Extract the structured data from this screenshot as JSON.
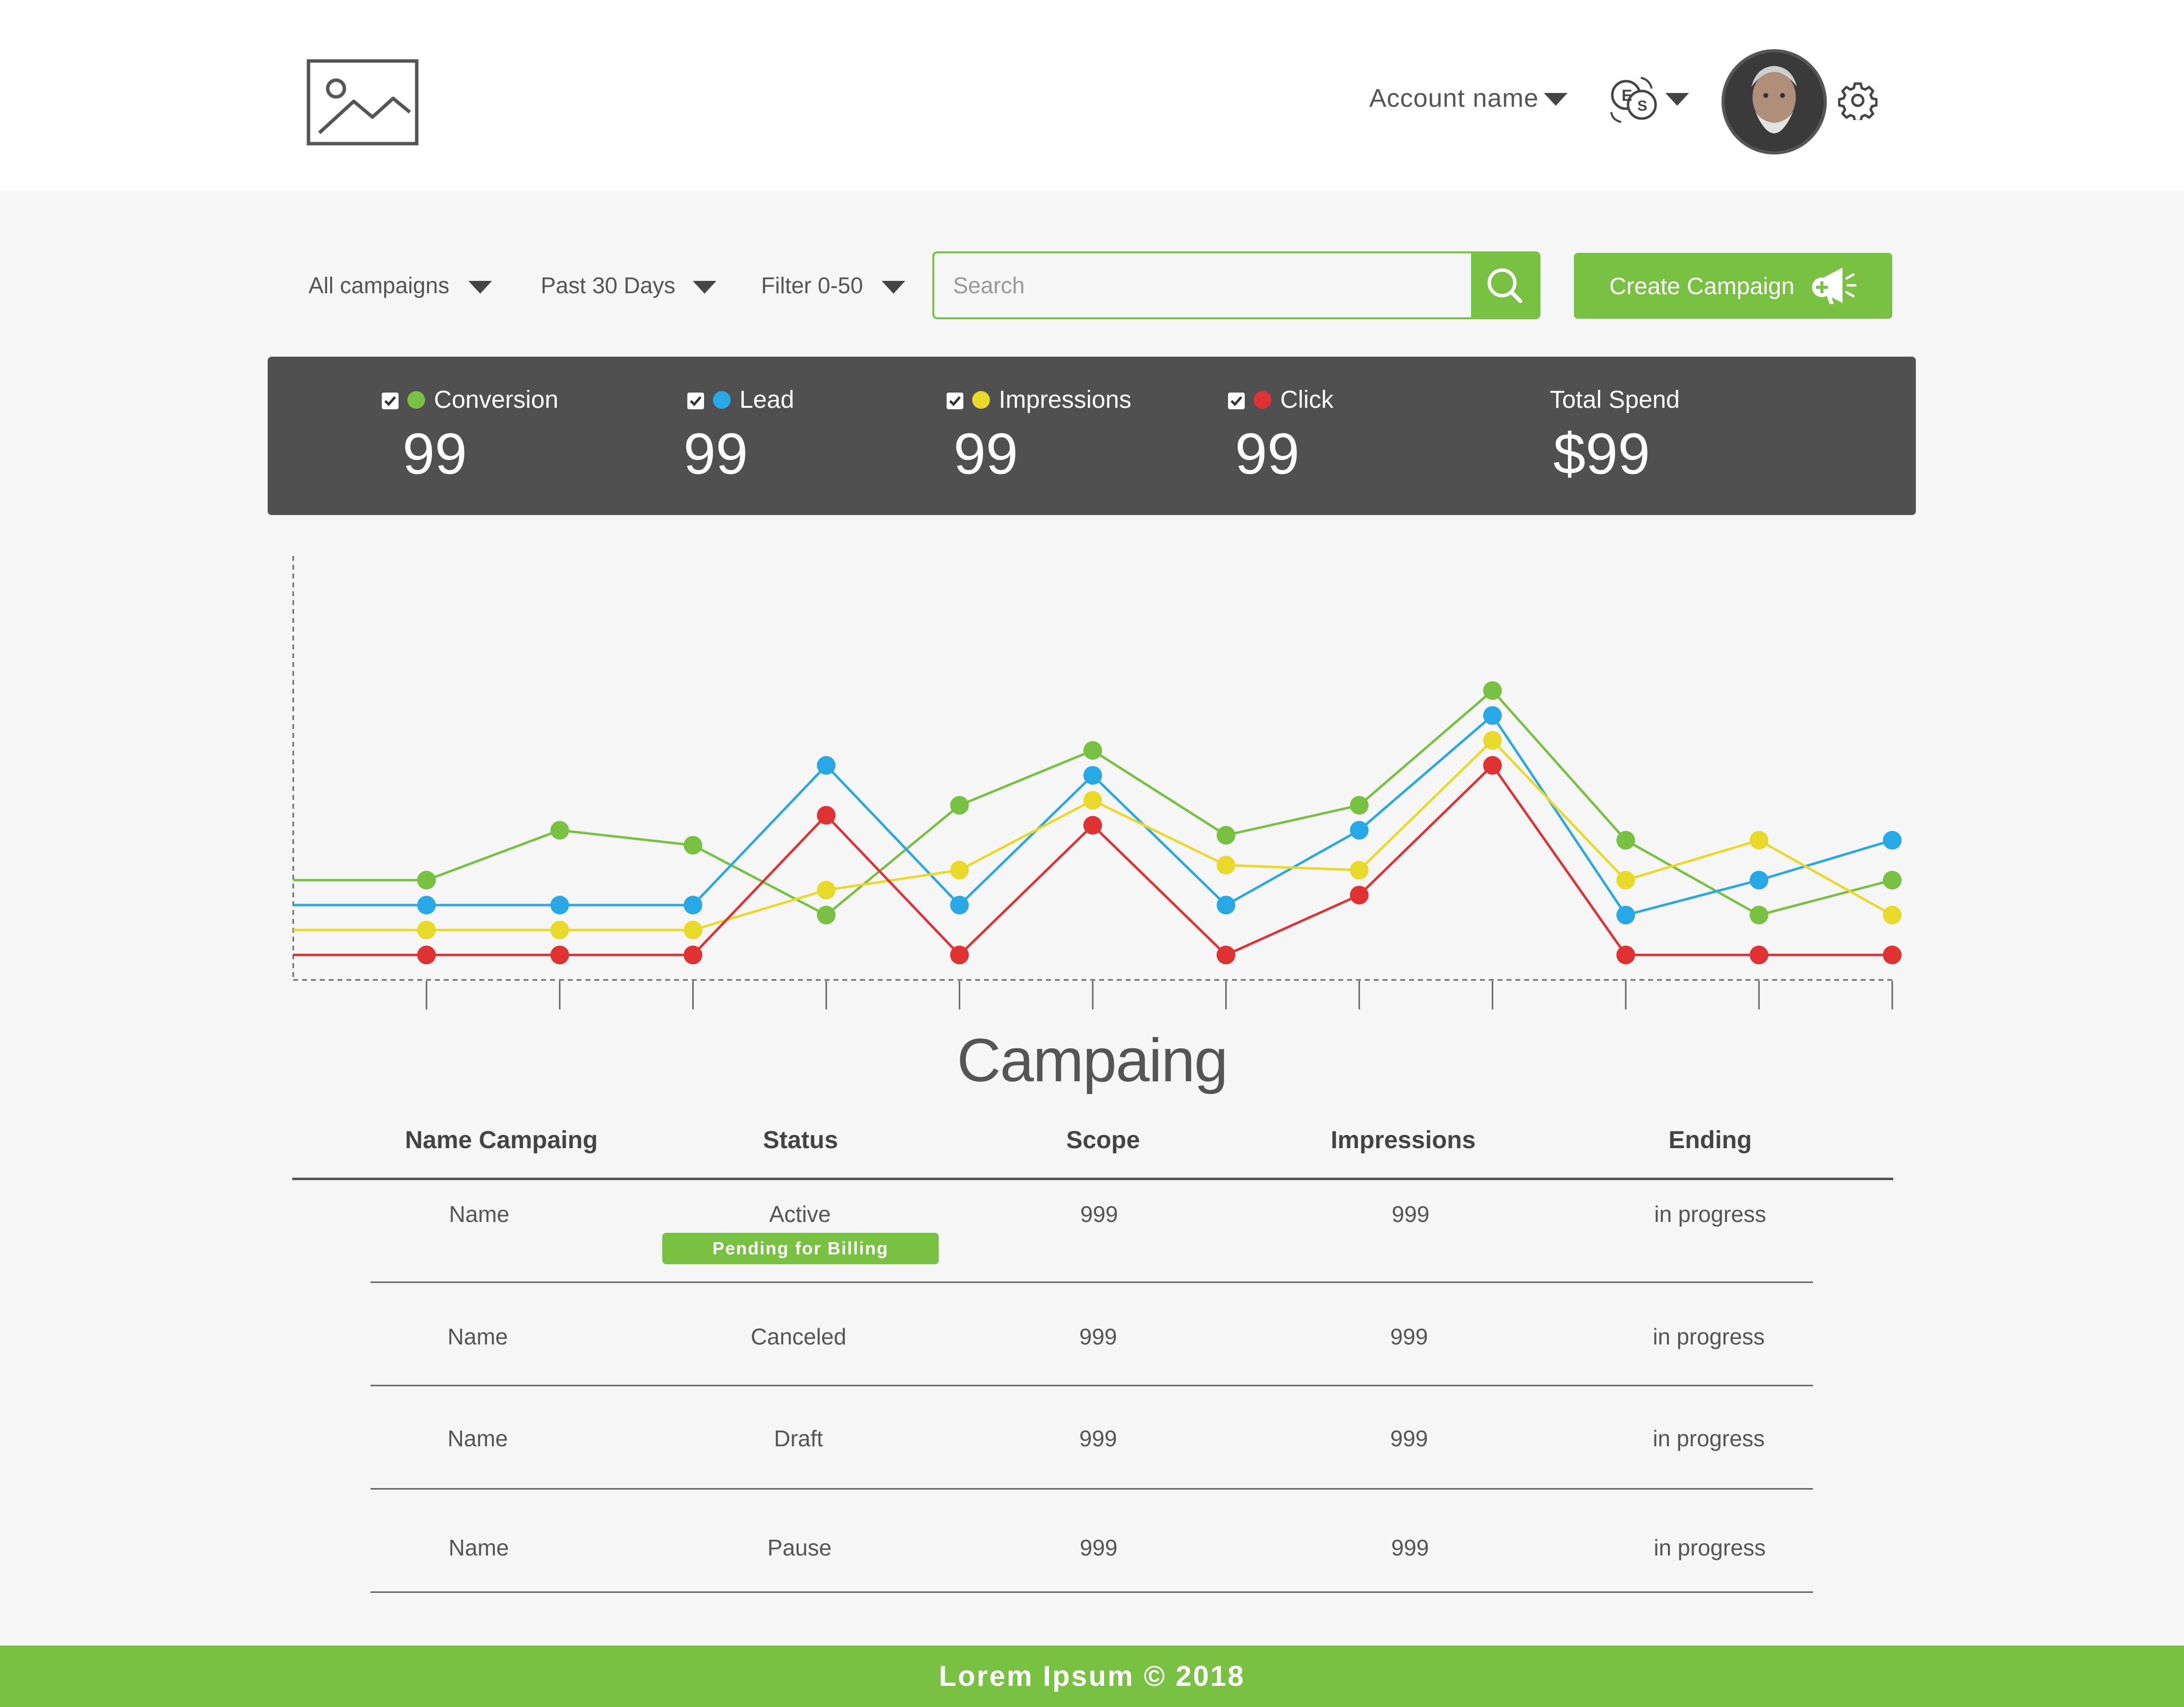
{
  "header": {
    "account_name": "Account name",
    "language_icon": "currency-exchange-icon",
    "settings_icon": "gear-icon",
    "logo_icon": "image-placeholder-icon"
  },
  "toolbar": {
    "campaign_filter": "All campaigns",
    "date_filter": "Past 30 Days",
    "range_filter": "Filter 0-50",
    "search_placeholder": "Search",
    "search_value": "",
    "create_label": "Create Campaign",
    "create_icon": "megaphone-plus-icon"
  },
  "stats": [
    {
      "label": "Conversion",
      "value": "99",
      "color": "#79c142",
      "checked": true
    },
    {
      "label": "Lead",
      "value": "99",
      "color": "#29a8e6",
      "checked": true
    },
    {
      "label": "Impressions",
      "value": "99",
      "color": "#e8d92a",
      "checked": true
    },
    {
      "label": "Click",
      "value": "99",
      "color": "#e03232",
      "checked": true
    }
  ],
  "total_spend": {
    "label": "Total Spend",
    "value": "$99"
  },
  "chart_data": {
    "type": "line",
    "x": [
      1,
      2,
      3,
      4,
      5,
      6,
      7,
      8,
      9,
      10,
      11,
      12
    ],
    "grid": false,
    "series": [
      {
        "name": "Conversion",
        "color": "#79c142",
        "start": 20,
        "values": [
          20,
          30,
          27,
          13,
          35,
          46,
          29,
          35,
          58,
          28,
          13,
          20
        ]
      },
      {
        "name": "Lead",
        "color": "#29a8e6",
        "start": 15,
        "values": [
          15,
          15,
          15,
          43,
          15,
          41,
          15,
          30,
          53,
          13,
          20,
          28
        ]
      },
      {
        "name": "Impressions",
        "color": "#e8d92a",
        "start": 10,
        "values": [
          10,
          10,
          10,
          18,
          22,
          36,
          23,
          22,
          48,
          20,
          28,
          13
        ]
      },
      {
        "name": "Click",
        "color": "#e03232",
        "start": 5,
        "values": [
          5,
          5,
          5,
          33,
          5,
          31,
          5,
          17,
          43,
          5,
          5,
          5
        ]
      }
    ],
    "ylim": [
      0,
      85
    ]
  },
  "table": {
    "title": "Campaing",
    "columns": [
      "Name Campaing",
      "Status",
      "Scope",
      "Impressions",
      "Ending"
    ],
    "rows": [
      {
        "name": "Name",
        "status": "Active",
        "badge": "Pending for Billing",
        "scope": "999",
        "impressions": "999",
        "ending": "in progress"
      },
      {
        "name": "Name",
        "status": "Canceled",
        "scope": "999",
        "impressions": "999",
        "ending": "in progress"
      },
      {
        "name": "Name",
        "status": "Draft",
        "scope": "999",
        "impressions": "999",
        "ending": "in progress"
      },
      {
        "name": "Name",
        "status": "Pause",
        "scope": "999",
        "impressions": "999",
        "ending": "in progress"
      }
    ]
  },
  "footer": {
    "text": "Lorem Ipsum  ©  2018"
  }
}
